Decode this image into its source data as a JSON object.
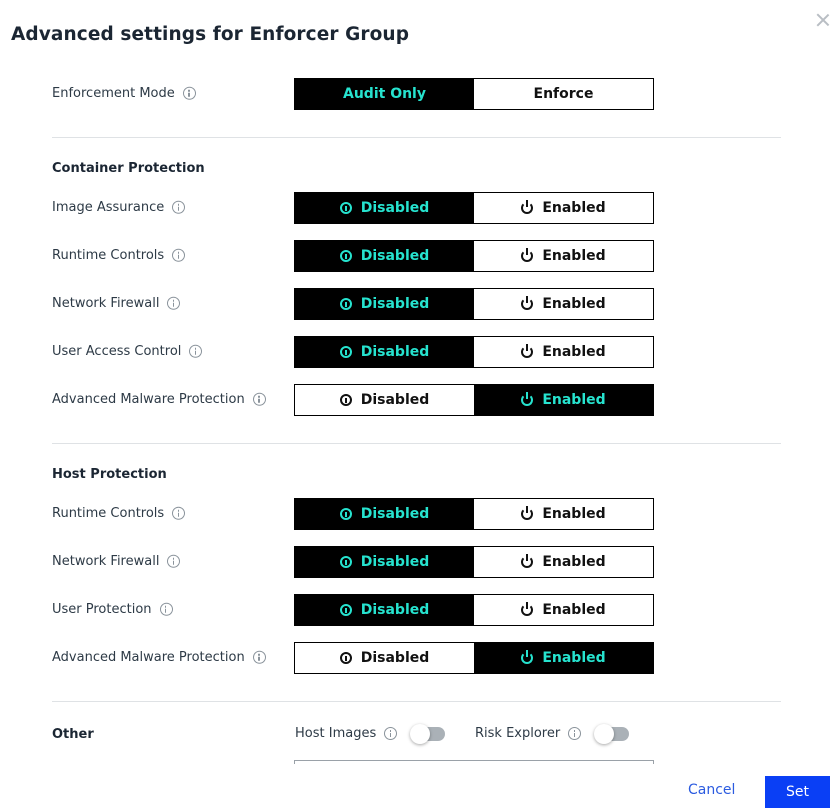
{
  "dialog": {
    "title": "Advanced settings for Enforcer Group",
    "close_icon": "close-icon"
  },
  "enforcement_mode": {
    "label": "Enforcement Mode",
    "options": [
      "Audit Only",
      "Enforce"
    ],
    "selected": "Audit Only"
  },
  "container_protection": {
    "heading": "Container Protection",
    "items": [
      {
        "label": "Image Assurance",
        "disabled_label": "Disabled",
        "enabled_label": "Enabled",
        "selected": "Disabled"
      },
      {
        "label": "Runtime Controls",
        "disabled_label": "Disabled",
        "enabled_label": "Enabled",
        "selected": "Disabled"
      },
      {
        "label": "Network Firewall",
        "disabled_label": "Disabled",
        "enabled_label": "Enabled",
        "selected": "Disabled"
      },
      {
        "label": "User Access Control",
        "disabled_label": "Disabled",
        "enabled_label": "Enabled",
        "selected": "Disabled"
      },
      {
        "label": "Advanced Malware Protection",
        "disabled_label": "Disabled",
        "enabled_label": "Enabled",
        "selected": "Enabled"
      }
    ]
  },
  "host_protection": {
    "heading": "Host Protection",
    "items": [
      {
        "label": "Runtime Controls",
        "disabled_label": "Disabled",
        "enabled_label": "Enabled",
        "selected": "Disabled"
      },
      {
        "label": "Network Firewall",
        "disabled_label": "Disabled",
        "enabled_label": "Enabled",
        "selected": "Disabled"
      },
      {
        "label": "User Protection",
        "disabled_label": "Disabled",
        "enabled_label": "Enabled",
        "selected": "Disabled"
      },
      {
        "label": "Advanced Malware Protection",
        "disabled_label": "Disabled",
        "enabled_label": "Enabled",
        "selected": "Enabled"
      }
    ]
  },
  "other": {
    "heading": "Other",
    "host_images": {
      "label": "Host Images",
      "on": false
    },
    "risk_explorer": {
      "label": "Risk Explorer",
      "on": false
    }
  },
  "footer": {
    "cancel_label": "Cancel",
    "set_label": "Set"
  },
  "colors": {
    "active_bg": "#000000",
    "active_text": "#26e3cf",
    "primary_button": "#0a3ff5",
    "link": "#2b5be0"
  }
}
